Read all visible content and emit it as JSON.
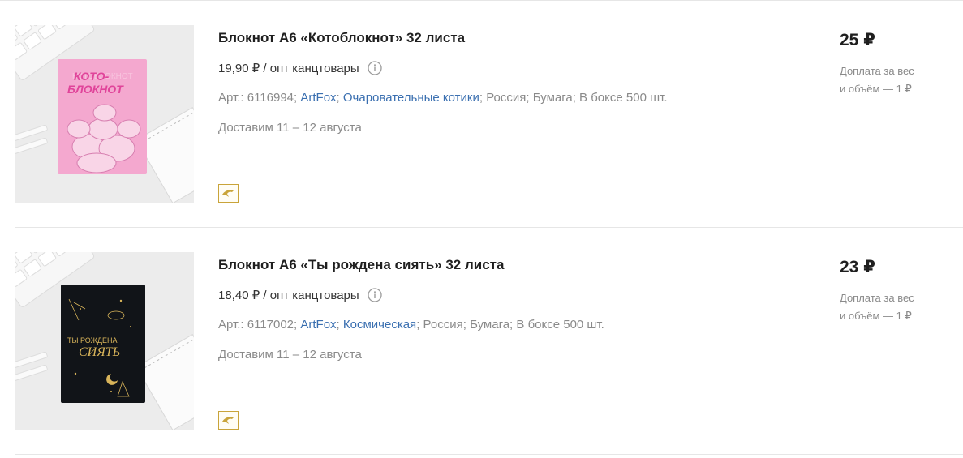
{
  "products": [
    {
      "title": "Блокнот А6 «Котоблокнот» 32 листа",
      "opt_price": "19,90 ₽ / опт канцтовары",
      "art": "Арт.: 6116994;",
      "brand": "ArtFox",
      "series": "Очаровательные котики",
      "country": "Россия;",
      "material": "Бумага;",
      "box": "В боксе 500 шт.",
      "delivery": "Доставим 11 – 12 августа",
      "price": "25 ₽",
      "surcharge_line1": "Доплата за вес",
      "surcharge_line2": "и объём — 1 ₽",
      "cover_text_line1": "КОТО-",
      "cover_text_line2": "БЛОКНОТ",
      "cover_color": "#f4a8cf"
    },
    {
      "title": "Блокнот А6 «Ты рождена сиять» 32 листа",
      "opt_price": "18,40 ₽ / опт канцтовары",
      "art": "Арт.: 6117002;",
      "brand": "ArtFox",
      "series": "Космическая",
      "country": "Россия;",
      "material": "Бумага;",
      "box": "В боксе 500 шт.",
      "delivery": "Доставим 11 – 12 августа",
      "price": "23 ₽",
      "surcharge_line1": "Доплата за вес",
      "surcharge_line2": "и объём — 1 ₽",
      "cover_text_line1": "ТЫ РОЖДЕНА",
      "cover_text_line2": "СИЯТЬ",
      "cover_color": "#111418"
    }
  ],
  "colors": {
    "link": "#3a6fb0",
    "muted": "#8a8a8a",
    "badge_border": "#c9a43a",
    "cat_cover_text": "#e0449a",
    "cosmic_cover_text": "#d8b45a"
  },
  "icons": {
    "info": "info-circle-icon",
    "badge": "dolphin-icon"
  }
}
